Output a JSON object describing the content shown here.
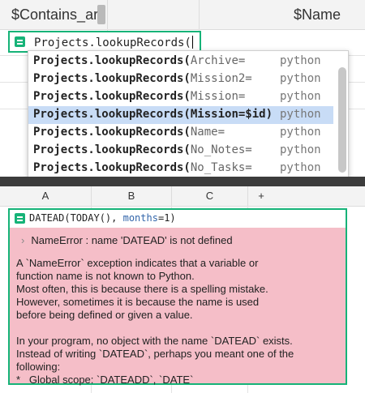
{
  "top_grid": {
    "columns": [
      "$Contains_ar",
      "$Name"
    ],
    "editor": {
      "formula_text": "Projects.lookupRecords("
    },
    "autocomplete": {
      "items": [
        {
          "fn": "Projects.lookupRecords(",
          "arg": "Archive=",
          "source": "python",
          "selected": false
        },
        {
          "fn": "Projects.lookupRecords(",
          "arg": "Mission2=",
          "source": "python",
          "selected": false
        },
        {
          "fn": "Projects.lookupRecords(",
          "arg": "Mission=",
          "source": "python",
          "selected": false
        },
        {
          "fn": "Projects.lookupRecords(",
          "arg": "Mission=$id)",
          "source": "python",
          "selected": true
        },
        {
          "fn": "Projects.lookupRecords(",
          "arg": "Name=",
          "source": "python",
          "selected": false
        },
        {
          "fn": "Projects.lookupRecords(",
          "arg": "No_Notes=",
          "source": "python",
          "selected": false
        },
        {
          "fn": "Projects.lookupRecords(",
          "arg": "No_Tasks=",
          "source": "python",
          "selected": false
        }
      ]
    }
  },
  "bottom_grid": {
    "columns": [
      "A",
      "B",
      "C",
      "+"
    ],
    "editor": {
      "fn": "DATEAD",
      "args_before": "(TODAY(), ",
      "kw": "months",
      "args_after": "=1)"
    },
    "error": {
      "title": "NameError : name 'DATEAD' is not defined",
      "lines": [
        "A `NameError` exception indicates that a variable or",
        "function name is not known to Python.",
        "Most often, this is because there is a spelling mistake.",
        "However, sometimes it is because the name is used",
        "before being defined or given a value.",
        "",
        "In your program, no object with the name `DATEAD` exists.",
        "Instead of writing `DATEAD`, perhaps you meant one of the",
        "following:",
        "*   Global scope: `DATEADD`, `DATE`"
      ]
    }
  },
  "colors": {
    "accent": "#16b378",
    "error_bg": "#f5bec8",
    "selection": "#c8dcf6"
  }
}
